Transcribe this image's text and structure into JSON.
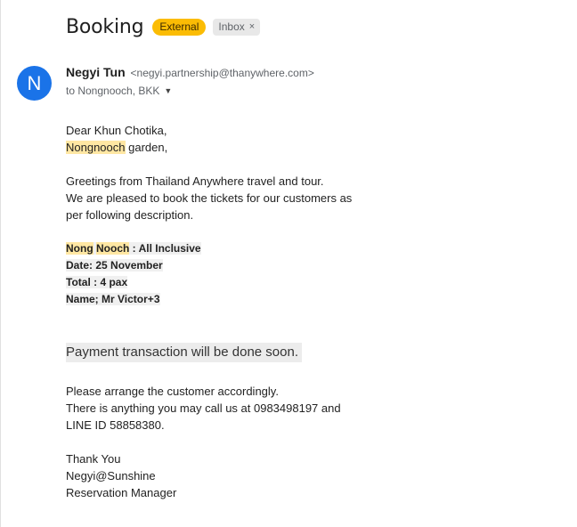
{
  "email": {
    "subject": "Booking",
    "labels": {
      "external": "External",
      "inbox": "Inbox",
      "inbox_remove": "×"
    },
    "sender": {
      "avatar_letter": "N",
      "name": "Negyi Tun",
      "email": "<negyi.partnership@thanywhere.com>",
      "to_line": "to Nongnooch, BKK"
    },
    "body": {
      "greeting": "Dear Khun Chotika,",
      "greeting2_highlight": "Nongnooch",
      "greeting2_rest": " garden,",
      "intro1": "Greetings from Thailand Anywhere travel and tour.",
      "intro2": "We are pleased to book the tickets for our customers as",
      "intro3": "per following description.",
      "pkg_hl1": "Nong",
      "pkg_hl2": "Nooch",
      "pkg_rest": " : All Inclusive",
      "date": "Date: 25 November",
      "total": "Total : 4 pax",
      "name": "Name; Mr Victor+3",
      "payment": "Payment transaction will be done soon.",
      "arrange": "Please arrange the customer accordingly.",
      "call": "There is anything you may call us at 0983498197 and",
      "line_id": "LINE ID 58858380.",
      "thanks": "Thank You",
      "signature": "Negyi@Sunshine",
      "title": "Reservation Manager"
    }
  },
  "colors": {
    "external_badge": "#fbbc04",
    "avatar": "#1a73e8",
    "highlight": "#ffe7a3"
  }
}
